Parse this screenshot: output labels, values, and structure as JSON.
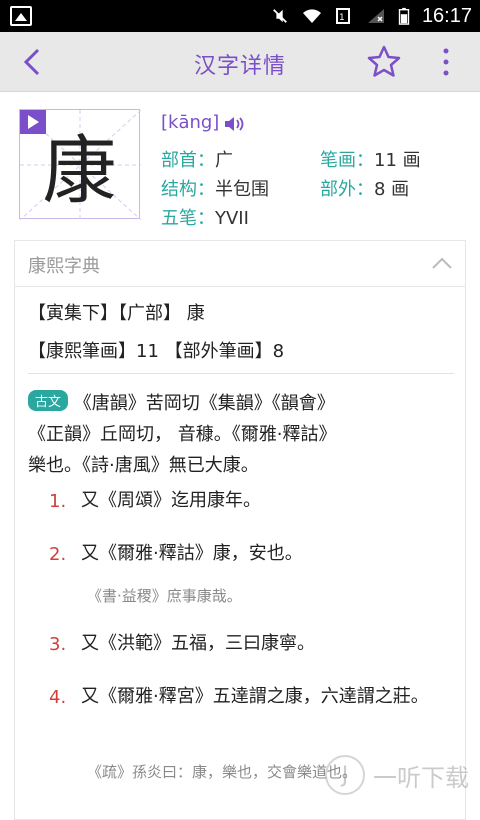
{
  "status": {
    "time": "16:17"
  },
  "appbar": {
    "title": "汉字详情"
  },
  "char": {
    "glyph": "康",
    "pinyin": "[kāng]",
    "radical_label": "部首：",
    "radical": "广",
    "strokes_label": "笔画：",
    "strokes": "11 画",
    "structure_label": "结构：",
    "structure": "半包围",
    "outer_label": "部外：",
    "outer": "8 画",
    "wubi_label": "五笔：",
    "wubi": "YVII"
  },
  "card": {
    "title": "康熙字典",
    "line1": "【寅集下】【广部】 康",
    "line2": "【康熙筆画】11 【部外筆画】8",
    "tag": "古文",
    "ancient_1": "《唐韻》苦岡切《集韻》《韻會》",
    "ancient_2": "《正韻》丘岡切， 音穅。《爾雅·釋詁》",
    "ancient_3": "樂也。《詩·唐風》無已大康。",
    "items": [
      {
        "num": "1.",
        "text": "又《周頌》迄用康年。",
        "sub": ""
      },
      {
        "num": "2.",
        "text": "又《爾雅·釋詁》康，安也。",
        "sub": "《書·益稷》庶事康哉。"
      },
      {
        "num": "3.",
        "text": "又《洪範》五福，三曰康寧。",
        "sub": ""
      },
      {
        "num": "4.",
        "text": "又《爾雅·釋宮》五達謂之康，六達謂之莊。",
        "sub": "《疏》孫炎曰：康，樂也，交會樂道也。"
      }
    ]
  },
  "watermark": {
    "text": "一听下载"
  }
}
